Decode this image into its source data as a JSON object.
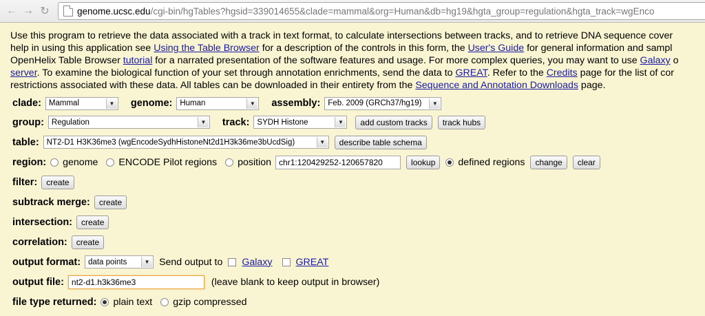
{
  "browser": {
    "url_host": "genome.ucsc.edu",
    "url_path": "/cgi-bin/hgTables?hgsid=339014655&clade=mammal&org=Human&db=hg19&hgta_group=regulation&hgta_track=wgEnco"
  },
  "intro": {
    "line1": "Use this program to retrieve the data associated with a track in text format, to calculate intersections between tracks, and to retrieve DNA sequence cover",
    "line2_a": "help in using this application see ",
    "line2_link1": "Using the Table Browser",
    "line2_b": " for a description of the controls in this form, the ",
    "line2_link2": "User's Guide",
    "line2_c": " for general information and sampl",
    "line3_a": "OpenHelix Table Browser ",
    "line3_link": "tutorial",
    "line3_b": " for a narrated presentation of the software features and usage. For more complex queries, you may want to use ",
    "line3_link2": "Galaxy",
    "line3_c": " o",
    "line4_link": "server",
    "line4_a": ". To examine the biological function of your set through annotation enrichments, send the data to ",
    "line4_link2": "GREAT",
    "line4_b": ". Refer to the ",
    "line4_link3": "Credits",
    "line4_c": " page for the list of cor",
    "line5_a": "restrictions associated with these data. All tables can be downloaded in their entirety from the ",
    "line5_link": "Sequence and Annotation Downloads",
    "line5_b": " page."
  },
  "form": {
    "clade_label": "clade:",
    "clade_value": "Mammal",
    "genome_label": "genome:",
    "genome_value": "Human",
    "assembly_label": "assembly:",
    "assembly_value": "Feb. 2009 (GRCh37/hg19)",
    "group_label": "group:",
    "group_value": "Regulation",
    "track_label": "track:",
    "track_value": "SYDH Histone",
    "add_custom_tracks": "add custom tracks",
    "track_hubs": "track hubs",
    "table_label": "table:",
    "table_value": "NT2-D1 H3K36me3 (wgEncodeSydhHistoneNt2d1H3k36me3bUcdSig)",
    "describe_schema": "describe table schema",
    "region_label": "region:",
    "region_genome": "genome",
    "region_encode": "ENCODE Pilot regions",
    "region_position": "position",
    "position_value": "chr1:120429252-120657820",
    "lookup": "lookup",
    "region_defined": "defined regions",
    "change": "change",
    "clear": "clear",
    "filter_label": "filter:",
    "create": "create",
    "subtrack_label": "subtrack merge:",
    "intersection_label": "intersection:",
    "correlation_label": "correlation:",
    "output_format_label": "output format:",
    "output_format_value": "data points",
    "send_output_to": "Send output to",
    "galaxy": "Galaxy",
    "great": "GREAT",
    "output_file_label": "output file:",
    "output_file_value": "nt2-d1.h3k36me3",
    "output_file_hint": "(leave blank to keep output in browser)",
    "file_type_label": "file type returned:",
    "plain_text": "plain text",
    "gzip": "gzip compressed"
  }
}
